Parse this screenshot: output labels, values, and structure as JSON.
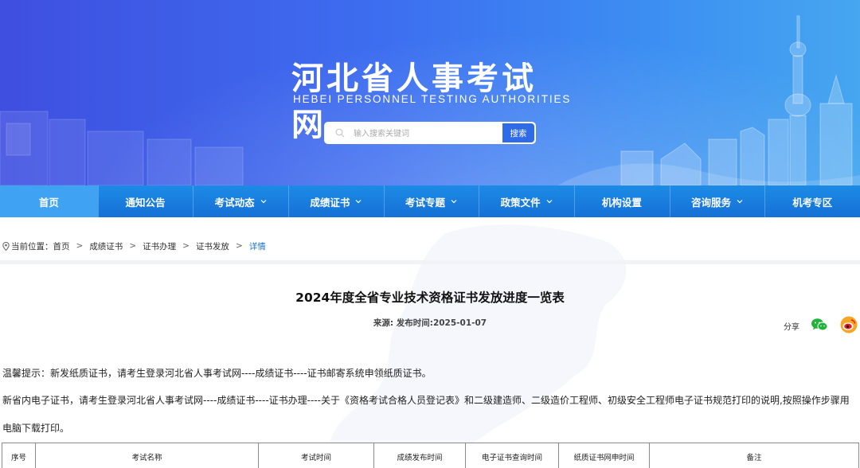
{
  "header": {
    "site_title": "河北省人事考试网",
    "site_subtitle": "HEBEI PERSONNEL TESTING AUTHORITIES",
    "search": {
      "placeholder": "输入搜索关键词",
      "button_label": "搜索"
    }
  },
  "nav": {
    "items": [
      {
        "label": "首页",
        "dropdown": false,
        "active": true
      },
      {
        "label": "通知公告",
        "dropdown": false,
        "active": false
      },
      {
        "label": "考试动态",
        "dropdown": true,
        "active": false
      },
      {
        "label": "成绩证书",
        "dropdown": true,
        "active": false
      },
      {
        "label": "考试专题",
        "dropdown": true,
        "active": false
      },
      {
        "label": "政策文件",
        "dropdown": true,
        "active": false
      },
      {
        "label": "机构设置",
        "dropdown": false,
        "active": false
      },
      {
        "label": "咨询服务",
        "dropdown": true,
        "active": false
      },
      {
        "label": "机考专区",
        "dropdown": false,
        "active": false
      }
    ]
  },
  "breadcrumb": {
    "prefix": "当前位置：",
    "items": [
      "首页",
      "成绩证书",
      "证书办理",
      "证书发放",
      "详情"
    ],
    "separator": ">"
  },
  "article": {
    "title": "2024年度全省专业技术资格证书发放进度一览表",
    "meta": "来源:  发布时间:2025-01-07",
    "share_label": "分享",
    "paragraph_1": "温馨提示：新发纸质证书，请考生登录河北省人事考试网----成绩证书----证书邮寄系统申领纸质证书。",
    "paragraph_2": "新省内电子证书，请考生登录河北省人事考试网----成绩证书----证书办理----关于《资格考试合格人员登记表》和二级建造师、二级造价工程师、初级安全工程师电子证书规范打印的说明,按照操作步骤用",
    "paragraph_3": "电脑下载打印。"
  },
  "table": {
    "headers": [
      "序号",
      "考试名称",
      "考试时间",
      "成绩发布时间",
      "电子证书查询时间",
      "纸质证书网申时间",
      "备注"
    ]
  },
  "colors": {
    "nav_bg": "#1570d6",
    "nav_active": "#3fa2f2",
    "banner_start": "#3f4fe0",
    "banner_end": "#46a6f0",
    "link_current": "#1b73d6",
    "search_button": "#2f6ae8"
  },
  "icons": {
    "search": "search-icon",
    "location": "location-pin-icon",
    "wechat": "wechat-icon",
    "weibo": "weibo-icon",
    "dropdown": "chevron-down-icon"
  }
}
